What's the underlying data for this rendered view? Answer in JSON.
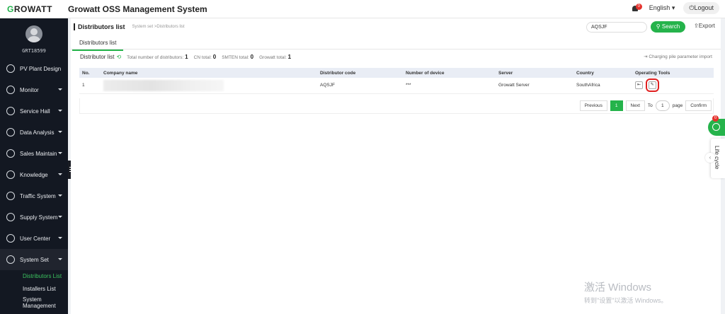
{
  "header": {
    "logo_text": "ROWATT",
    "logo_initial": "G",
    "system_title": "Growatt OSS Management System",
    "notification_count": "0",
    "language": "English ▾",
    "logout": "⏻Logout"
  },
  "sidebar": {
    "username": "GRT18599",
    "items": [
      {
        "label": "PV Plant Design",
        "has_caret": false
      },
      {
        "label": "Monitor",
        "has_caret": true
      },
      {
        "label": "Service Hall",
        "has_caret": true
      },
      {
        "label": "Data Analysis",
        "has_caret": true
      },
      {
        "label": "Sales Maintain",
        "has_caret": true
      },
      {
        "label": "Knowledge",
        "has_caret": true
      },
      {
        "label": "Traffic System",
        "has_caret": true
      },
      {
        "label": "Supply System",
        "has_caret": true
      },
      {
        "label": "User Center",
        "has_caret": true
      },
      {
        "label": "System Set",
        "has_caret": true
      }
    ],
    "submenu": [
      "Distributors List",
      "Installers List",
      "System Management"
    ]
  },
  "page": {
    "title": "Distributors list",
    "breadcrumb": "System set >Distributors list",
    "search_value": "AQSJF",
    "search_label": "Search",
    "export_label": "Export",
    "tab_label": "Distributors list"
  },
  "summary": {
    "list_label": "Distributor list",
    "total_label": "Total number of distributors:",
    "total_value": "1",
    "cn_label": "CN total:",
    "cn_value": "0",
    "smten_label": "SMTEN total:",
    "smten_value": "0",
    "growatt_label": "Growatt total:",
    "growatt_value": "1",
    "charging_link": "Charging pile parameter import"
  },
  "table": {
    "columns": [
      "No.",
      "Company name",
      "Distributor code",
      "Number of device",
      "Server",
      "Country",
      "Operating Tools"
    ],
    "rows": [
      {
        "no": "1",
        "company": "",
        "code": "AQSJF",
        "devices": "***",
        "server": "Growatt Server",
        "country": "SouthAfrica"
      }
    ]
  },
  "pagination": {
    "previous": "Previous",
    "current": "1",
    "next": "Next",
    "to": "To",
    "page_input": "1",
    "page_word": "page",
    "confirm": "Confirm"
  },
  "widgets": {
    "float_badge": "0",
    "lifecycle": "Life cycle"
  },
  "watermark": {
    "line1": "激活 Windows",
    "line2": "转到\"设置\"以激活 Windows。"
  },
  "colors": {
    "accent": "#25b34b",
    "sidebar_bg": "#131822",
    "highlight": "#e02020"
  }
}
